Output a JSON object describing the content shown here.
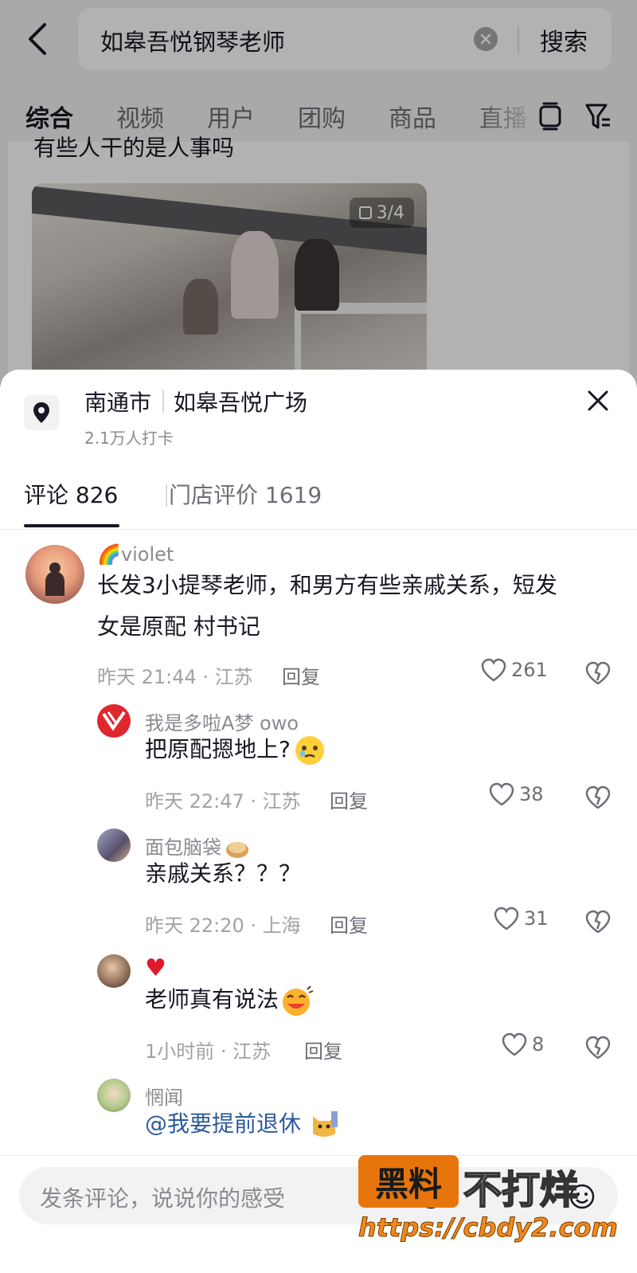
{
  "search": {
    "query": "如皋吾悦钢琴老师",
    "search_button": "搜索"
  },
  "tabs": [
    "综合",
    "视频",
    "用户",
    "团购",
    "商品",
    "直播"
  ],
  "post": {
    "title": "有些人干的是人事吗",
    "image_counter": "3/4"
  },
  "location": {
    "city": "南通市",
    "place": "如皋吾悦广场",
    "checkins": "2.1万人打卡"
  },
  "sheet_tabs": {
    "comments": "评论 826",
    "reviews": "门店评价 1619"
  },
  "comments": [
    {
      "user": "violet",
      "user_emoji": "🌈",
      "text_line1": "长发3小提琴老师，和男方有些亲戚关系，短发",
      "text_line2": "女是原配 村书记",
      "meta": "昨天 21:44 · 江苏",
      "reply": "回复",
      "likes": "261"
    },
    {
      "user": "我是多啦A梦 owo",
      "text": "把原配摁地上?",
      "meta": "昨天 22:47 · 江苏",
      "reply": "回复",
      "likes": "38"
    },
    {
      "user": "面包脑袋",
      "text": "亲戚关系？？？",
      "meta": "昨天 22:20 · 上海",
      "reply": "回复",
      "likes": "31"
    },
    {
      "user": "♥",
      "text": "老师真有说法",
      "meta": "1小时前 · 江苏",
      "reply": "回复",
      "likes": "8"
    },
    {
      "user": "惘闻",
      "text": "@我要提前退休"
    }
  ],
  "input": {
    "placeholder": "发条评论，说说你的感受"
  },
  "watermark": {
    "badge": "黑料",
    "text": "不打烊",
    "url": "https://cbdy2.com"
  },
  "colors": {
    "accent_red": "#e0262f",
    "heart_red": "#e01a2b",
    "mention_blue": "#2d5a9c",
    "watermark_orange": "#e8740c"
  }
}
